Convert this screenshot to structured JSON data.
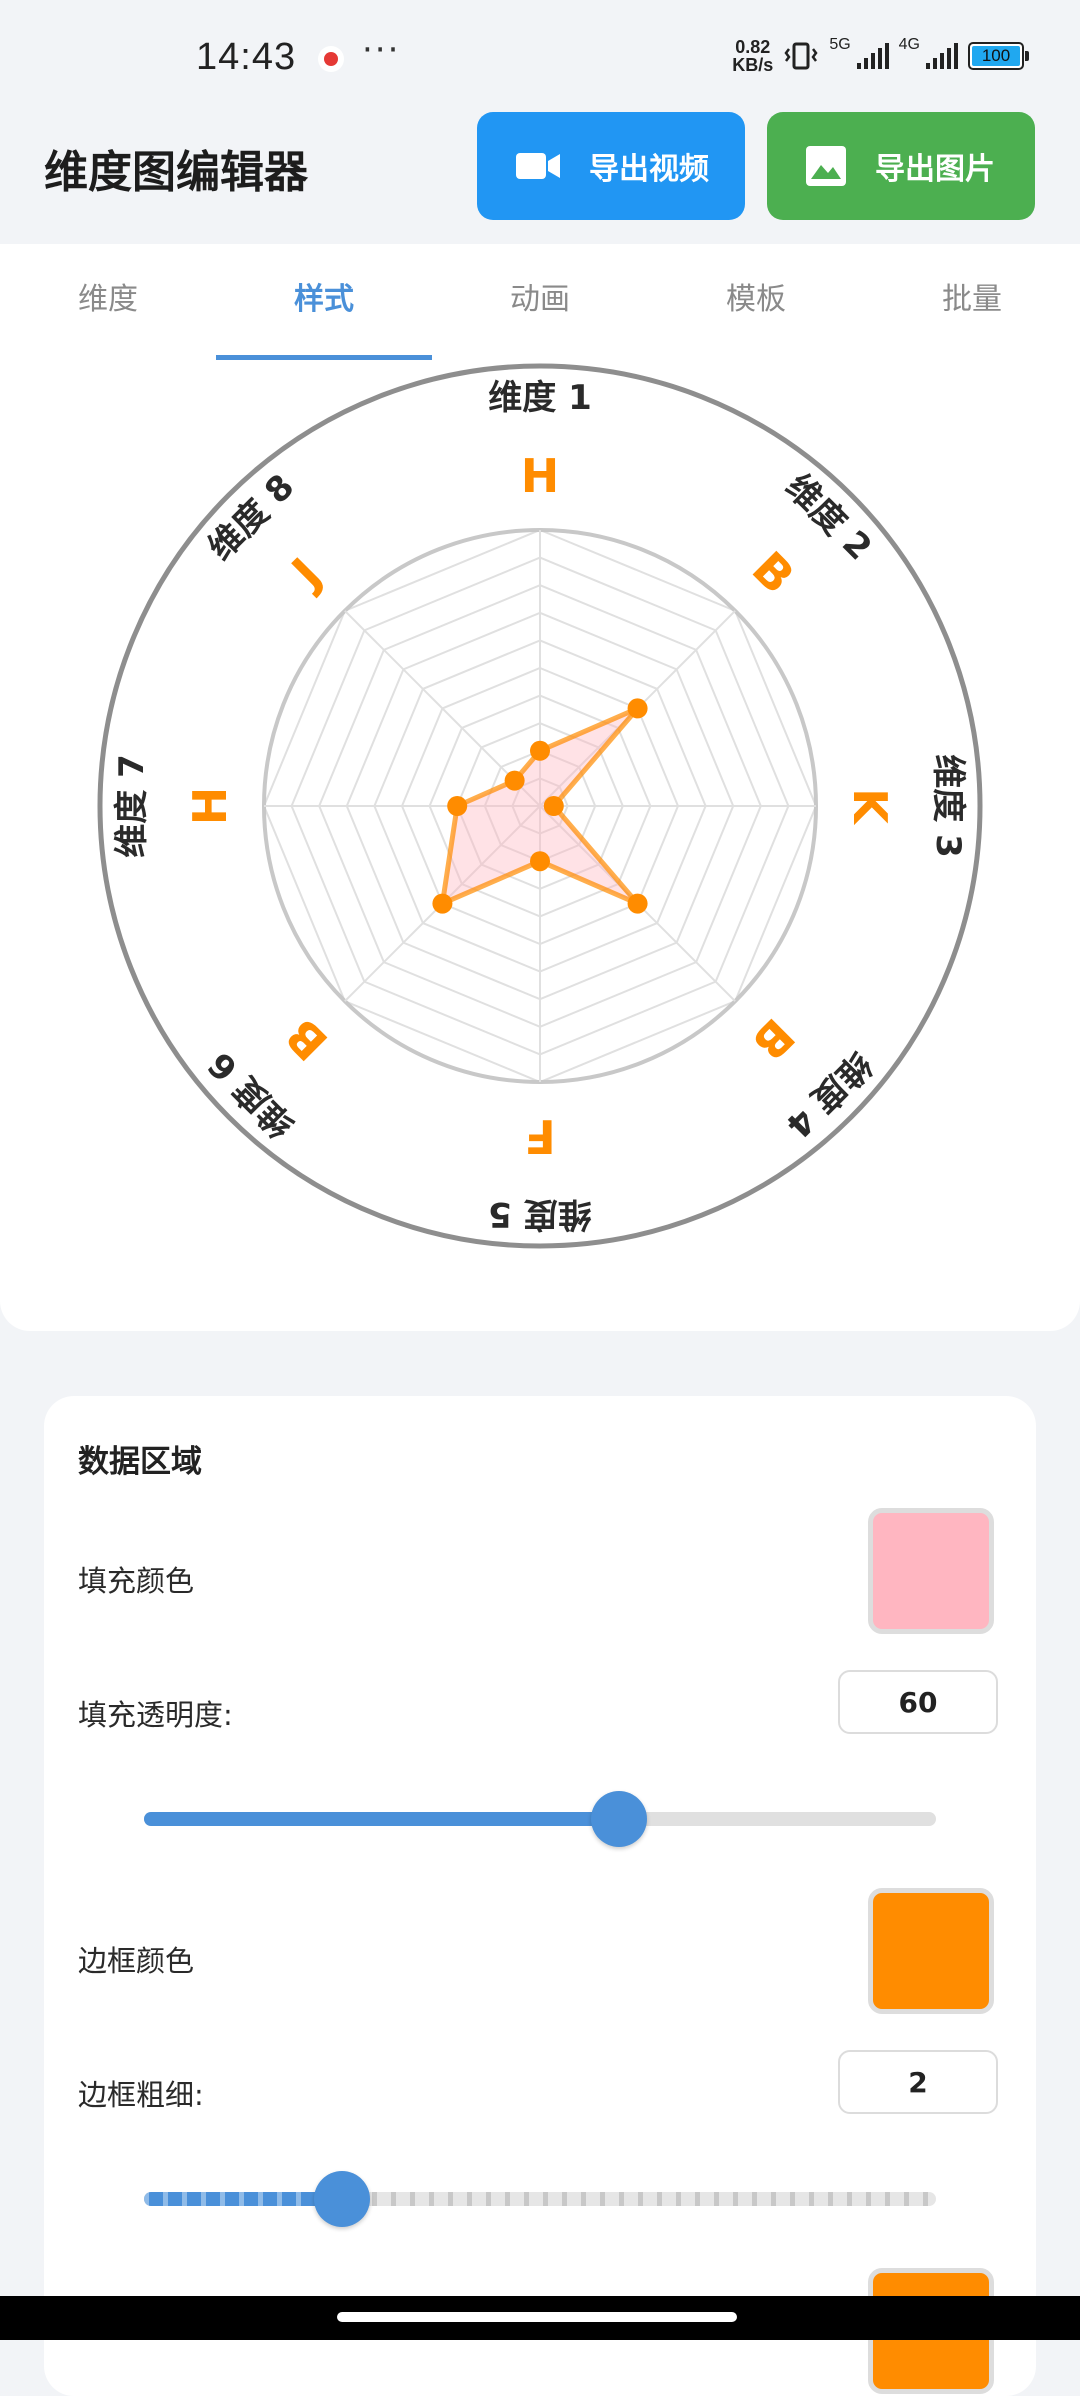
{
  "status": {
    "time": "14:43",
    "more": "···",
    "netspeed_value": "0.82",
    "netspeed_unit": "KB/s",
    "sig1": "5G",
    "sig2": "4G",
    "battery": "100"
  },
  "header": {
    "title": "维度图编辑器",
    "export_video": "导出视频",
    "export_image": "导出图片",
    "video_color": "#2196f3",
    "image_color": "#4caf50"
  },
  "tabs": [
    {
      "label": "维度"
    },
    {
      "label": "样式",
      "active": true
    },
    {
      "label": "动画"
    },
    {
      "label": "模板"
    },
    {
      "label": "批量"
    }
  ],
  "chart_data": {
    "type": "radar",
    "axes": [
      "维度 1",
      "维度 2",
      "维度 3",
      "维度 4",
      "维度 5",
      "维度 6",
      "维度 7",
      "维度 8"
    ],
    "grades": [
      "H",
      "B",
      "K",
      "B",
      "F",
      "B",
      "H",
      "J"
    ],
    "values": [
      2,
      5,
      0.5,
      5,
      2,
      5,
      3,
      1.3
    ],
    "max": 10,
    "levels": 10,
    "fill_color": "#ffb6c1",
    "stroke_color": "#ff8c00",
    "grade_color": "#ff8c00"
  },
  "settings": {
    "section_title": "数据区域",
    "fill_color_label": "填充颜色",
    "fill_color": "#ffb6c1",
    "fill_opacity_label": "填充透明度:",
    "fill_opacity": "60",
    "fill_opacity_fraction": 0.6,
    "border_color_label": "边框颜色",
    "border_color": "#ff8c00",
    "border_width_label": "边框粗细:",
    "border_width": "2",
    "border_width_fraction": 0.25,
    "next_color": "#ff8c00"
  }
}
